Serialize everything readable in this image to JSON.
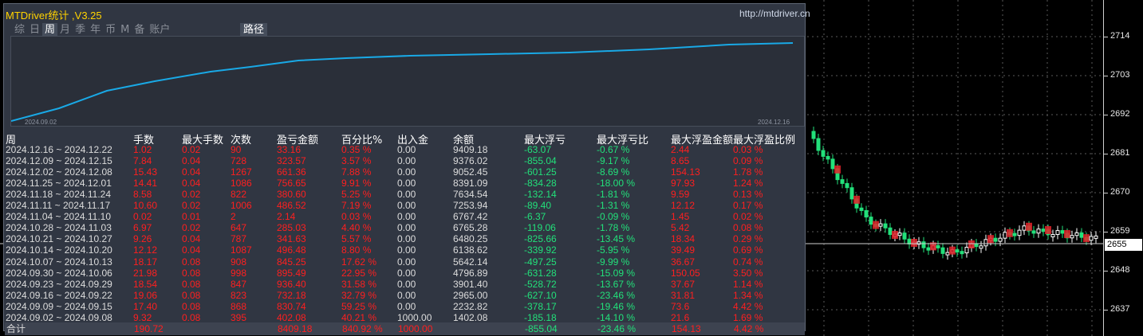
{
  "app": {
    "title": "MTDriver统计 ,V3.25",
    "url": "http://mtdriver.cn"
  },
  "tabs": [
    {
      "label": "综"
    },
    {
      "label": "日"
    },
    {
      "label": "周",
      "active": true
    },
    {
      "label": "月"
    },
    {
      "label": "季"
    },
    {
      "label": "年"
    },
    {
      "label": "币"
    },
    {
      "label": "M"
    },
    {
      "label": "备"
    },
    {
      "label": "账户"
    }
  ],
  "path_button": "路径",
  "equity_chart": {
    "start_date": "2024.09.02",
    "end_date": "2024.12.16",
    "line_color": "#19a9e6"
  },
  "table": {
    "columns": [
      "周",
      "手数",
      "最大手数",
      "次数",
      "盈亏金额",
      "百分比%",
      "出入金",
      "余额",
      "最大浮亏",
      "最大浮亏比",
      "最大浮盈金额",
      "最大浮盈比例"
    ],
    "rows": [
      [
        "2024.12.16 ~ 2024.12.22",
        "1.02",
        "0.02",
        "90",
        "33.16",
        "0.35 %",
        "0.00",
        "9409.18",
        "-63.07",
        "-0.67 %",
        "2.44",
        "0.03 %"
      ],
      [
        "2024.12.09 ~ 2024.12.15",
        "7.84",
        "0.04",
        "728",
        "323.57",
        "3.57 %",
        "0.00",
        "9376.02",
        "-855.04",
        "-9.17 %",
        "8.65",
        "0.09 %"
      ],
      [
        "2024.12.02 ~ 2024.12.08",
        "15.43",
        "0.04",
        "1267",
        "661.36",
        "7.88 %",
        "0.00",
        "9052.45",
        "-601.25",
        "-8.69 %",
        "154.13",
        "1.78 %"
      ],
      [
        "2024.11.25 ~ 2024.12.01",
        "14.41",
        "0.04",
        "1086",
        "756.65",
        "9.91 %",
        "0.00",
        "8391.09",
        "-834.28",
        "-18.00 %",
        "97.93",
        "1.24 %"
      ],
      [
        "2024.11.18 ~ 2024.11.24",
        "8.58",
        "0.02",
        "822",
        "380.60",
        "5.25 %",
        "0.00",
        "7634.54",
        "-132.14",
        "-1.81 %",
        "9.59",
        "0.13 %"
      ],
      [
        "2024.11.11 ~ 2024.11.17",
        "10.60",
        "0.02",
        "1006",
        "486.52",
        "7.19 %",
        "0.00",
        "7253.94",
        "-89.40",
        "-1.31 %",
        "12.12",
        "0.17 %"
      ],
      [
        "2024.11.04 ~ 2024.11.10",
        "0.02",
        "0.01",
        "2",
        "2.14",
        "0.03 %",
        "0.00",
        "6767.42",
        "-6.37",
        "-0.09 %",
        "1.45",
        "0.02 %"
      ],
      [
        "2024.10.28 ~ 2024.11.03",
        "6.97",
        "0.02",
        "647",
        "285.03",
        "4.40 %",
        "0.00",
        "6765.28",
        "-119.06",
        "-1.78 %",
        "5.42",
        "0.08 %"
      ],
      [
        "2024.10.21 ~ 2024.10.27",
        "9.26",
        "0.04",
        "787",
        "341.63",
        "5.57 %",
        "0.00",
        "6480.25",
        "-825.66",
        "-13.45 %",
        "18.34",
        "0.29 %"
      ],
      [
        "2024.10.14 ~ 2024.10.20",
        "12.12",
        "0.04",
        "1087",
        "496.48",
        "8.80 %",
        "0.00",
        "6138.62",
        "-339.92",
        "-5.95 %",
        "39.49",
        "0.69 %"
      ],
      [
        "2024.10.07 ~ 2024.10.13",
        "18.17",
        "0.08",
        "908",
        "845.25",
        "17.62 %",
        "0.00",
        "5642.14",
        "-497.25",
        "-9.99 %",
        "36.67",
        "0.74 %"
      ],
      [
        "2024.09.30 ~ 2024.10.06",
        "21.98",
        "0.08",
        "998",
        "895.49",
        "22.95 %",
        "0.00",
        "4796.89",
        "-631.28",
        "-15.09 %",
        "150.05",
        "3.50 %"
      ],
      [
        "2024.09.23 ~ 2024.09.29",
        "18.54",
        "0.08",
        "847",
        "936.40",
        "31.58 %",
        "0.00",
        "3901.40",
        "-528.72",
        "-13.67 %",
        "37.67",
        "1.14 %"
      ],
      [
        "2024.09.16 ~ 2024.09.22",
        "19.06",
        "0.08",
        "823",
        "732.18",
        "32.79 %",
        "0.00",
        "2965.00",
        "-627.10",
        "-23.46 %",
        "31.81",
        "1.34 %"
      ],
      [
        "2024.09.09 ~ 2024.09.15",
        "17.40",
        "0.08",
        "868",
        "830.74",
        "59.25 %",
        "0.00",
        "2232.82",
        "-378.17",
        "-19.46 %",
        "73.6",
        "4.42 %"
      ],
      [
        "2024.09.02 ~ 2024.09.08",
        "9.32",
        "0.08",
        "395",
        "402.08",
        "40.21 %",
        "1000.00",
        "1402.08",
        "-185.18",
        "-14.10 %",
        "21.6",
        "1.69 %"
      ]
    ],
    "total": {
      "label": "合计",
      "lots": "190.72",
      "pnl": "8409.18",
      "pct": "840.92 %",
      "io": "1000.00",
      "max_float_loss": "-855.04",
      "max_float_loss_pct": "-23.46 %",
      "max_float_profit": "154.13",
      "max_float_profit_pct": "4.42 %"
    }
  },
  "price_axis": {
    "labels": [
      "2714",
      "2703",
      "2692",
      "2681",
      "2670",
      "2659",
      "2648",
      "2637"
    ],
    "current": "2655"
  },
  "colors": {
    "panel_bg": "#303642",
    "red": "#ff1f1f",
    "green": "#22e07a",
    "title": "#ffd200"
  }
}
